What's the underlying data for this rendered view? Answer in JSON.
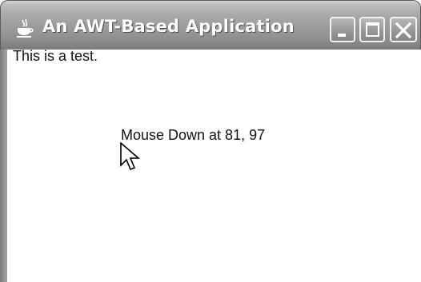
{
  "window": {
    "title": "An AWT-Based Application",
    "title_icon": "java-icon",
    "controls": {
      "minimize_icon": "minimize-icon",
      "maximize_icon": "maximize-icon",
      "close_icon": "close-icon"
    }
  },
  "content": {
    "static_text": "This is a test.",
    "mouse_message": "Mouse Down at 81, 97",
    "cursor_icon": "arrow-cursor-icon"
  },
  "colors": {
    "titlebar": "#9b9b9b",
    "title_text": "#ffffff",
    "background": "#ffffff",
    "text": "#111111"
  }
}
